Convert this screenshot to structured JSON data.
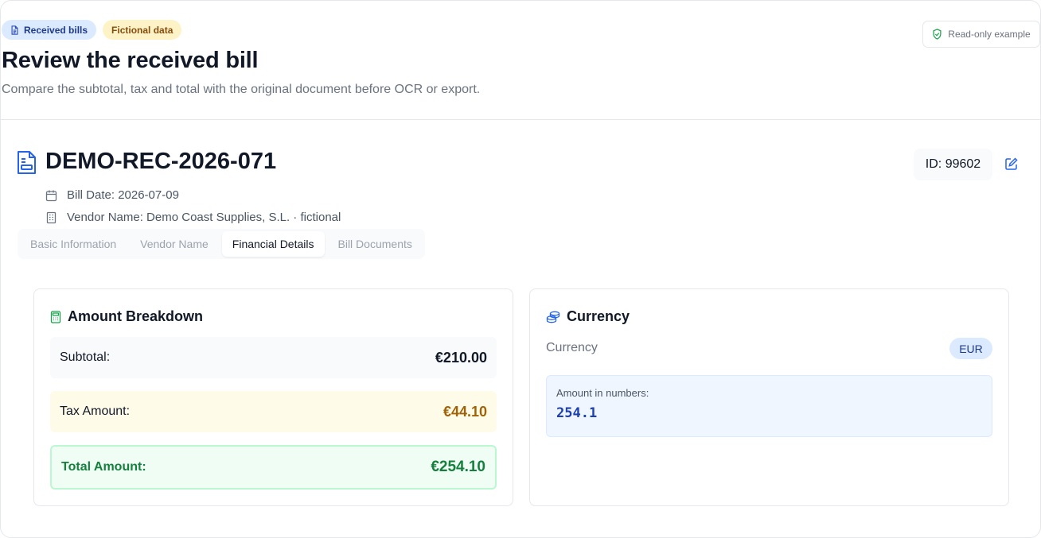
{
  "header": {
    "badge_received": "Received bills",
    "badge_fictional": "Fictional data",
    "title": "Review the received bill",
    "subtitle": "Compare the subtotal, tax and total with the original document before OCR or export.",
    "readonly_label": "Read-only example"
  },
  "bill": {
    "number": "DEMO-REC-2026-071",
    "date_line": "Bill Date: 2026-07-09",
    "vendor_line": "Vendor Name: Demo Coast Supplies, S.L. · fictional",
    "id_label": "ID: 99602"
  },
  "tabs": [
    {
      "label": "Basic Information",
      "active": false
    },
    {
      "label": "Vendor Name",
      "active": false
    },
    {
      "label": "Financial Details",
      "active": true
    },
    {
      "label": "Bill Documents",
      "active": false
    }
  ],
  "amounts": {
    "title": "Amount Breakdown",
    "subtotal_label": "Subtotal:",
    "subtotal_value": "€210.00",
    "tax_label": "Tax Amount:",
    "tax_value": "€44.10",
    "total_label": "Total Amount:",
    "total_value": "€254.10"
  },
  "currency": {
    "title": "Currency",
    "label": "Currency",
    "code": "EUR",
    "numbers_label": "Amount in numbers:",
    "numbers_value": "254.1"
  },
  "icons": {
    "badge_received": "document-icon",
    "readonly": "shield-check-icon",
    "bill": "file-invoice-icon",
    "date": "calendar-icon",
    "vendor": "building-icon",
    "edit": "edit-icon",
    "amounts": "calculator-icon",
    "currency": "coins-icon"
  },
  "colors": {
    "accent_blue": "#2563eb",
    "total_green": "#15803d",
    "tax_amber": "#a16207"
  }
}
